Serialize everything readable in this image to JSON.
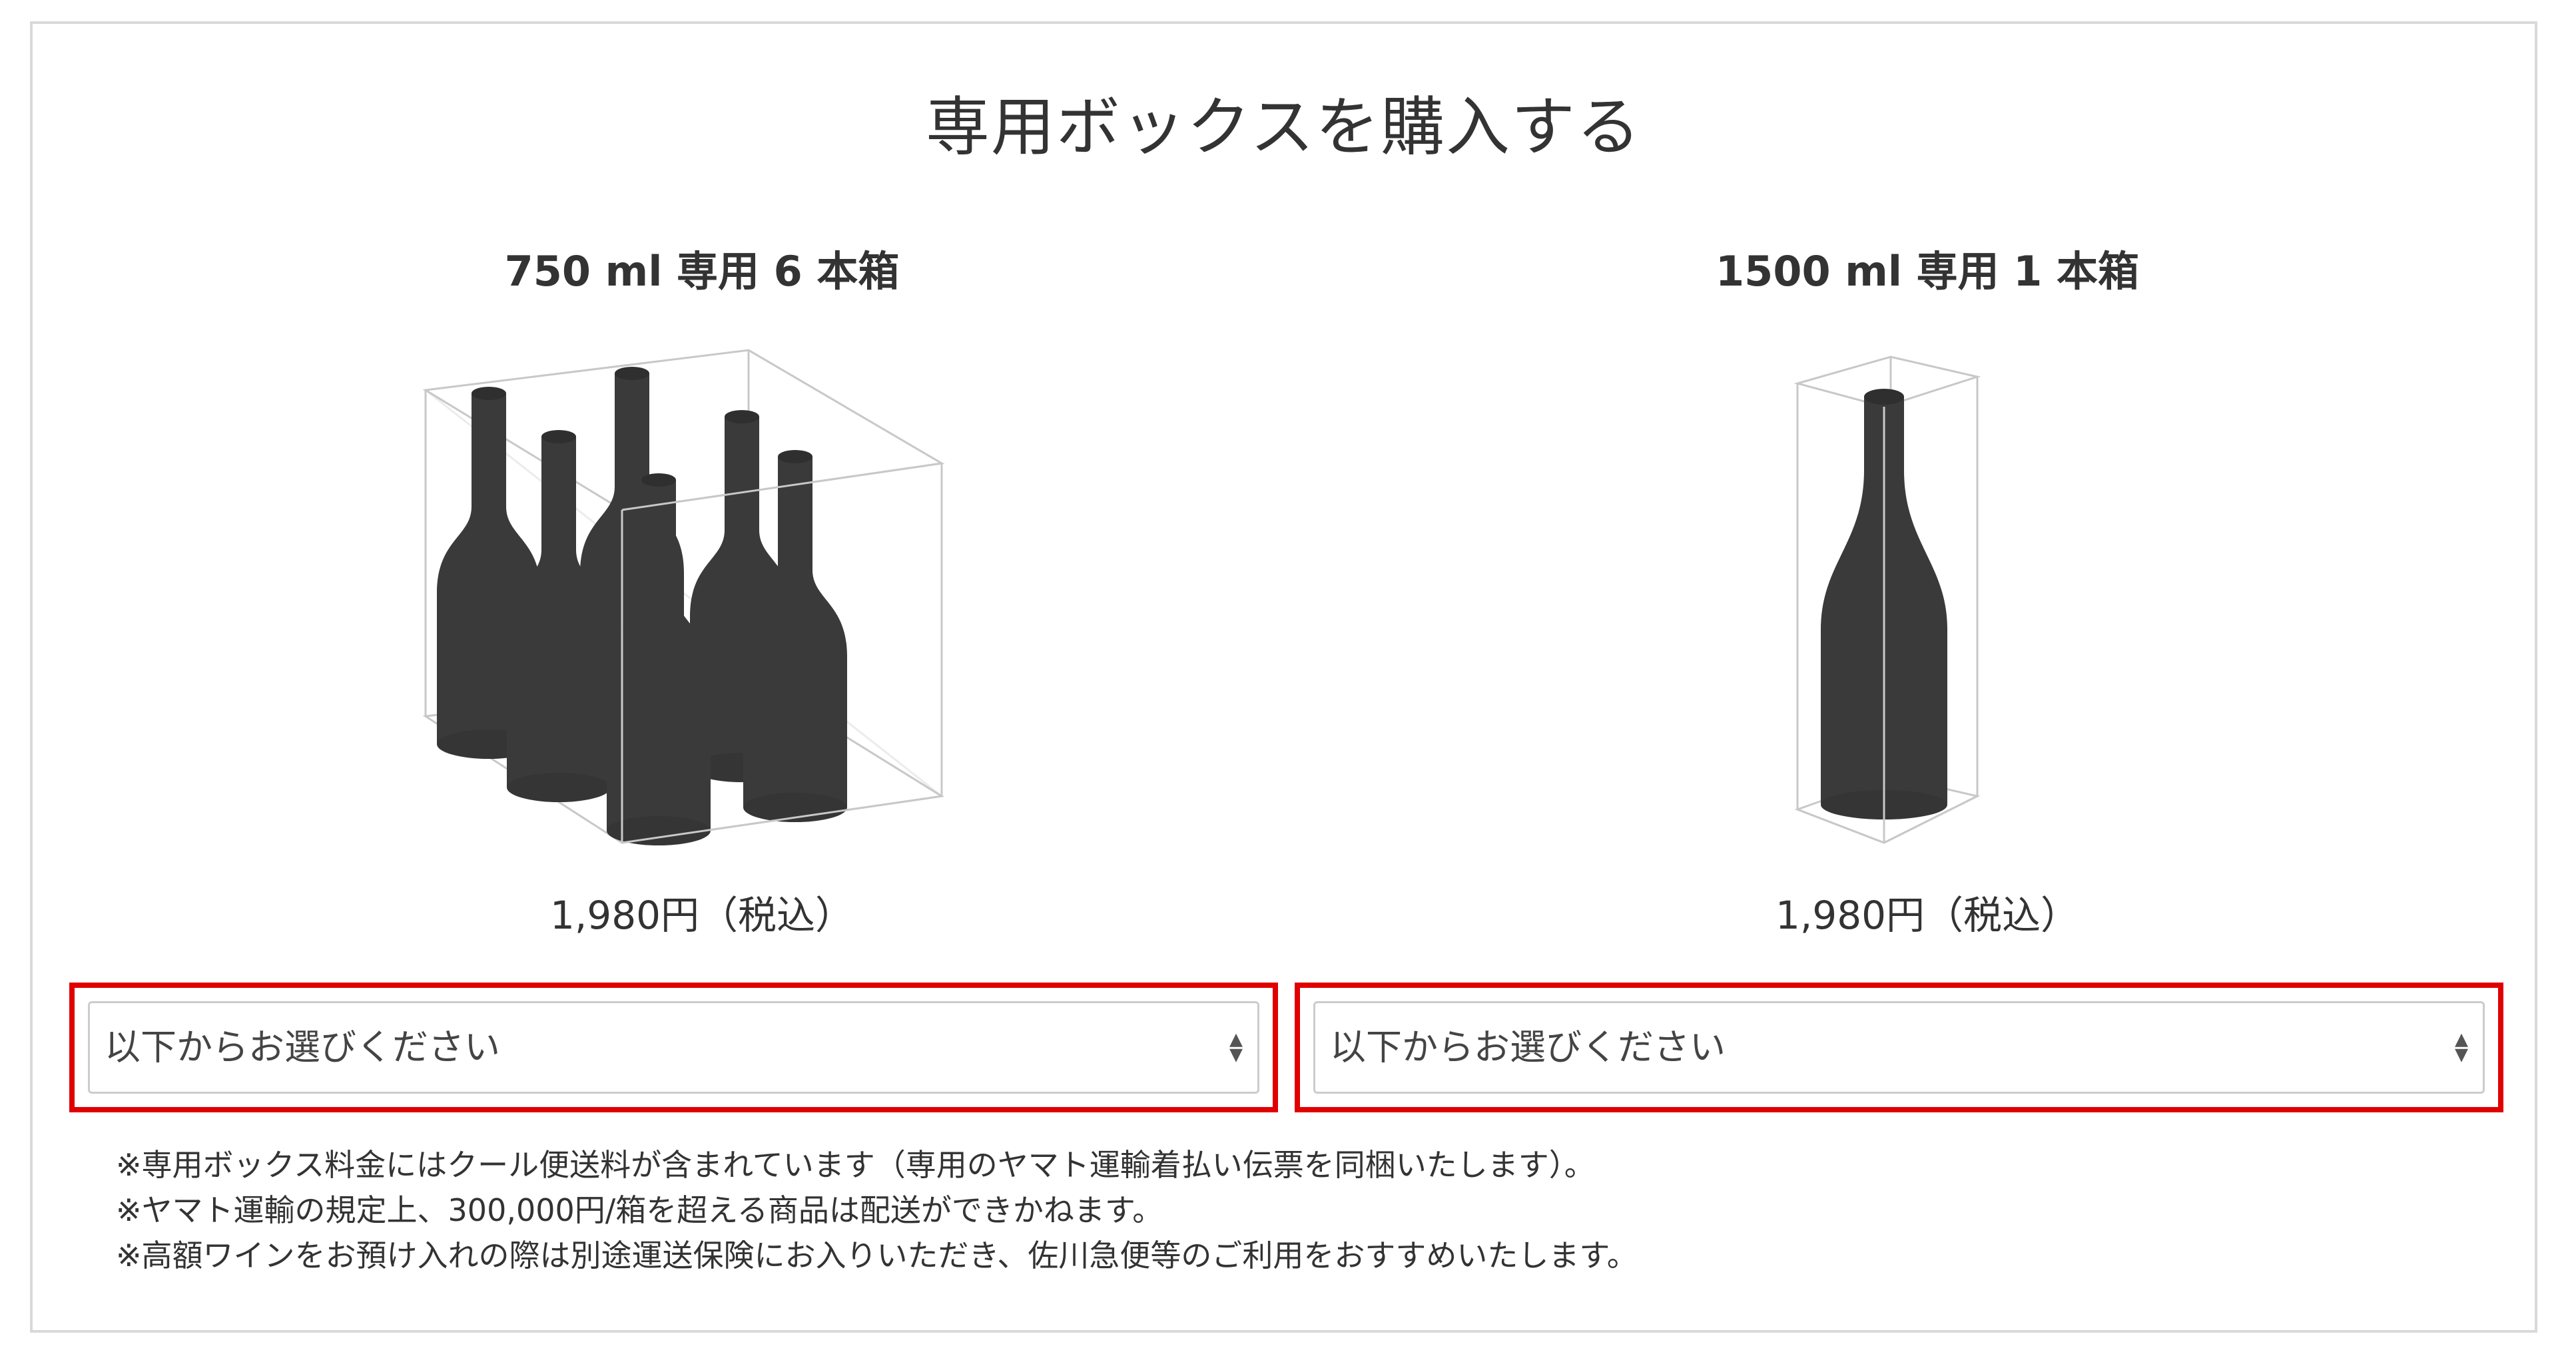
{
  "heading": "専用ボックスを購入する",
  "products": [
    {
      "title": "750 ml 専用 6 本箱",
      "price": "1,980円（税込）",
      "select_placeholder": "以下からお選びください",
      "illustration_icon": "six-bottle-box-icon"
    },
    {
      "title": "1500 ml 専用 1 本箱",
      "price": "1,980円（税込）",
      "select_placeholder": "以下からお選びください",
      "illustration_icon": "single-bottle-box-icon"
    }
  ],
  "select_arrows": "▲▼",
  "notes": [
    "※専用ボックス料金にはクール便送料が含まれています（専用のヤマト運輸着払い伝票を同梱いたします）。",
    "※ヤマト運輸の規定上、300,000円/箱を超える商品は配送ができかねます。",
    "※高額ワインをお預け入れの際は別途運送保険にお入りいただき、佐川急便等のご利用をおすすめいたします。"
  ],
  "colors": {
    "highlight": "#e00000",
    "bottle": "#3a3a3a",
    "box_line": "#c8c8c8",
    "panel_border": "#d9d9d9",
    "text": "#333333"
  }
}
